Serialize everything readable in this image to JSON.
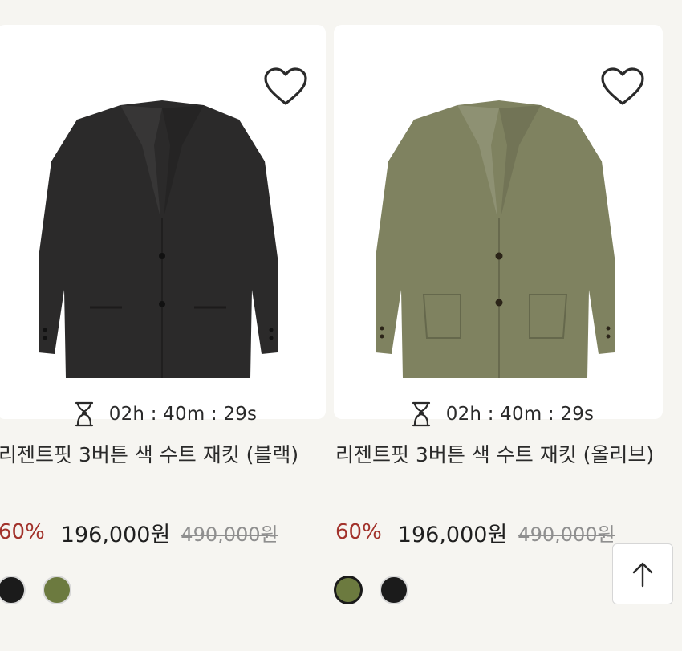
{
  "products": [
    {
      "title": "리젠트핏 3버튼 색 수트 재킷 (블랙)",
      "timer": "02h : 40m : 29s",
      "discount": "60%",
      "sale_price": "196,000원",
      "original_price": "490,000원",
      "jacket_color": "#2b2a2a",
      "swatches": [
        {
          "color_name": "black",
          "color": "#1b1b1b",
          "selected": false
        },
        {
          "color_name": "olive",
          "color": "#6c7a3f",
          "selected": false
        }
      ]
    },
    {
      "title": "리젠트핏 3버튼 색 수트 재킷 (올리브)",
      "timer": "02h : 40m : 29s",
      "discount": "60%",
      "sale_price": "196,000원",
      "original_price": "490,000원",
      "jacket_color": "#7f8260",
      "swatches": [
        {
          "color_name": "olive",
          "color": "#6c7a3f",
          "selected": true
        },
        {
          "color_name": "black",
          "color": "#1b1b1b",
          "selected": false
        }
      ]
    }
  ],
  "icons": {
    "wishlist": "heart-icon",
    "timer": "hourglass-icon",
    "scroll_top": "arrow-up-icon"
  },
  "colors": {
    "discount": "#a2322b",
    "background": "#f6f5f1",
    "card": "#ffffff"
  }
}
